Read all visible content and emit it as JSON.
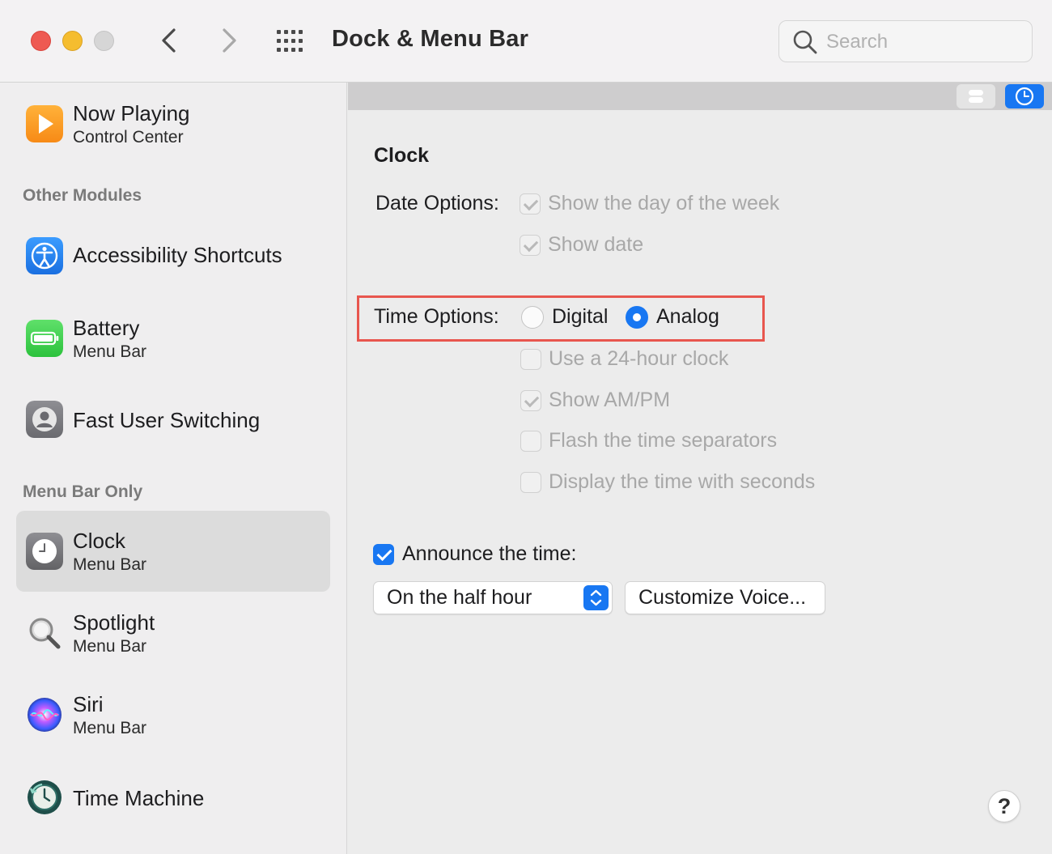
{
  "window": {
    "title": "Dock & Menu Bar",
    "search_placeholder": "Search"
  },
  "sidebar": {
    "items": [
      {
        "title": "Now Playing",
        "subtitle": "Control Center",
        "icon": "now-playing-icon"
      },
      {
        "title": "Accessibility Shortcuts",
        "subtitle": "",
        "icon": "accessibility-icon"
      },
      {
        "title": "Battery",
        "subtitle": "Menu Bar",
        "icon": "battery-icon"
      },
      {
        "title": "Fast User Switching",
        "subtitle": "",
        "icon": "user-icon"
      },
      {
        "title": "Clock",
        "subtitle": "Menu Bar",
        "icon": "clock-icon",
        "selected": true
      },
      {
        "title": "Spotlight",
        "subtitle": "Menu Bar",
        "icon": "spotlight-icon"
      },
      {
        "title": "Siri",
        "subtitle": "Menu Bar",
        "icon": "siri-icon"
      },
      {
        "title": "Time Machine",
        "subtitle": "",
        "icon": "time-machine-icon"
      }
    ],
    "headers": {
      "other_modules": "Other Modules",
      "menu_bar_only": "Menu Bar Only"
    }
  },
  "main": {
    "section_title": "Clock",
    "date_options": {
      "label": "Date Options:",
      "show_day_of_week": {
        "label": "Show the day of the week",
        "checked": true,
        "enabled": false
      },
      "show_date": {
        "label": "Show date",
        "checked": true,
        "enabled": false
      }
    },
    "time_options": {
      "label": "Time Options:",
      "digital": {
        "label": "Digital",
        "selected": false
      },
      "analog": {
        "label": "Analog",
        "selected": true
      },
      "use_24_hour": {
        "label": "Use a 24-hour clock",
        "checked": false,
        "enabled": false
      },
      "show_am_pm": {
        "label": "Show AM/PM",
        "checked": true,
        "enabled": false
      },
      "flash_separators": {
        "label": "Flash the time separators",
        "checked": false,
        "enabled": false
      },
      "show_seconds": {
        "label": "Display the time with seconds",
        "checked": false,
        "enabled": false
      }
    },
    "announce": {
      "label": "Announce the time:",
      "checked": true,
      "interval_value": "On the half hour",
      "customize_label": "Customize Voice..."
    },
    "help_label": "?"
  },
  "colors": {
    "accent": "#1877f2",
    "highlight_box": "#e8564e",
    "close": "#ee5a52",
    "minimize": "#f5bd2f"
  }
}
